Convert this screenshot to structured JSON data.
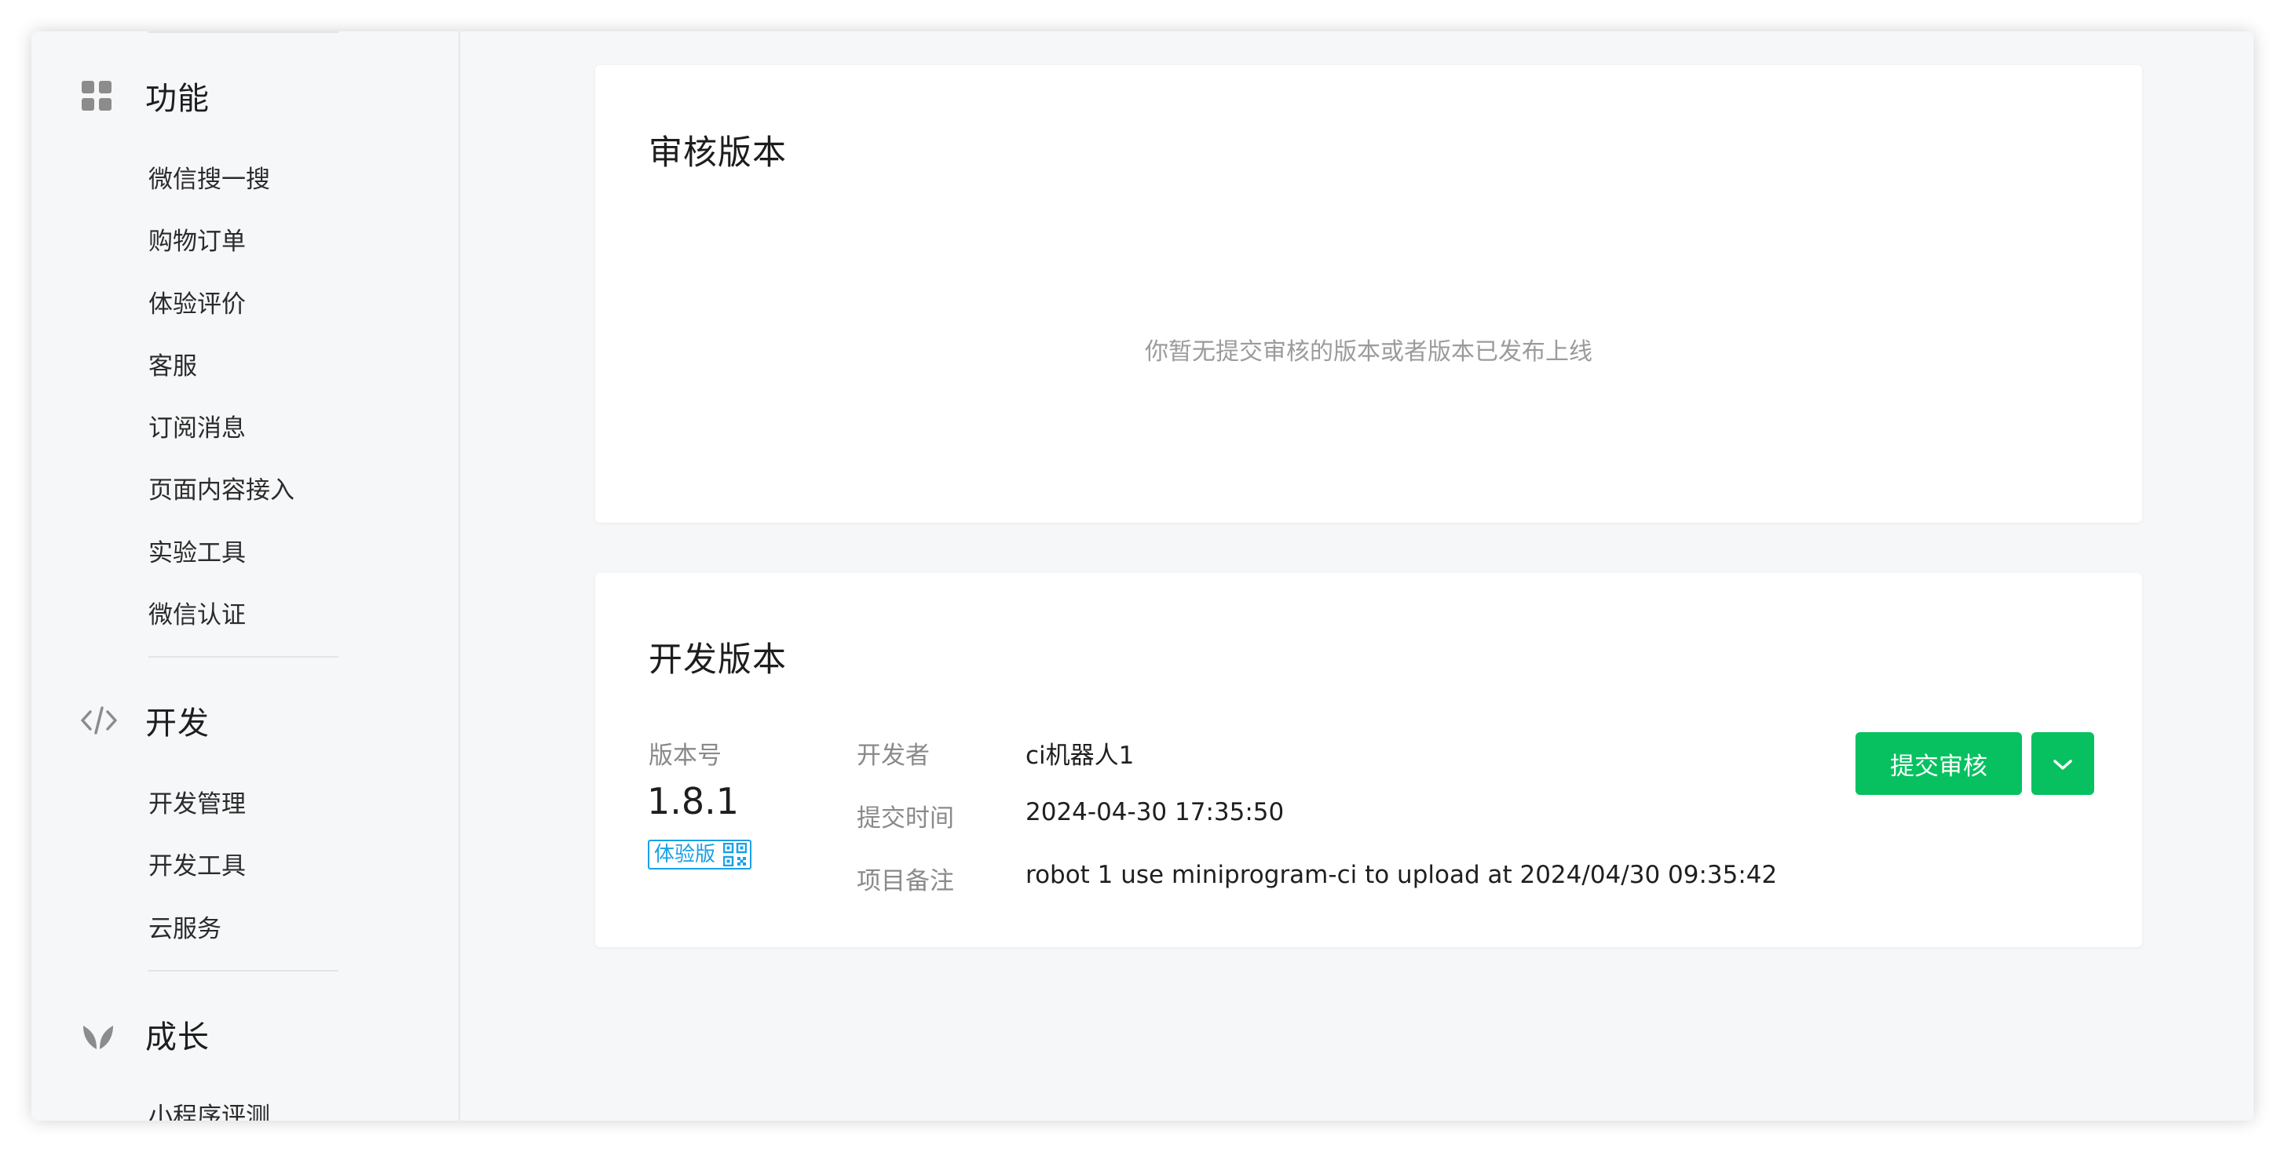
{
  "sidebar": {
    "groups": [
      {
        "title": "功能",
        "icon": "grid-icon",
        "items": [
          "微信搜一搜",
          "购物订单",
          "体验评价",
          "客服",
          "订阅消息",
          "页面内容接入",
          "实验工具",
          "微信认证"
        ]
      },
      {
        "title": "开发",
        "icon": "code-icon",
        "items": [
          "开发管理",
          "开发工具",
          "云服务"
        ]
      },
      {
        "title": "成长",
        "icon": "sprout-icon",
        "items": [
          "小程序评测"
        ]
      }
    ]
  },
  "review_card": {
    "title": "审核版本",
    "empty_message": "你暂无提交审核的版本或者版本已发布上线"
  },
  "dev_card": {
    "title": "开发版本",
    "version_label": "版本号",
    "version": "1.8.1",
    "tag": "体验版",
    "tag_icon": "qrcode-icon",
    "developer_label": "开发者",
    "developer": "ci机器人1",
    "submit_time_label": "提交时间",
    "submit_time": "2024-04-30 17:35:50",
    "remark_label": "项目备注",
    "remark": "robot 1 use miniprogram-ci to upload at 2024/04/30 09:35:42",
    "submit_button": "提交审核",
    "dropdown_icon": "chevron-down-icon"
  },
  "colors": {
    "brand_green": "#07c160",
    "tag_blue": "#1aa0e8",
    "page_bg": "#f6f7f9"
  }
}
